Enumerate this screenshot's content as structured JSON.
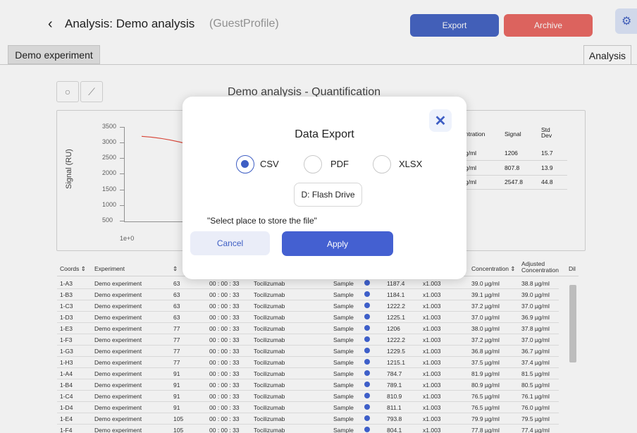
{
  "header": {
    "back_icon": "chevron-left-icon",
    "back_glyph": "‹",
    "title": "Analysis: Demo analysis",
    "profile": "(GuestProfile)",
    "export_label": "Export",
    "archive_label": "Archive",
    "settings_icon": "gear-icon",
    "settings_glyph": "⚙"
  },
  "tabs": {
    "left": "Demo experiment",
    "right": "Analysis"
  },
  "tools": {
    "circle_icon": "circle-select-icon",
    "circle_glyph": "○",
    "line_icon": "line-select-icon",
    "line_glyph": "⟋"
  },
  "chart": {
    "title": "Demo analysis - Quantification",
    "ylabel": "Signal (RU)",
    "yticks": [
      "3500",
      "3000",
      "2500",
      "2000",
      "1500",
      "1000",
      "500"
    ],
    "xtick": "1e+0"
  },
  "chart_data": {
    "type": "line",
    "title": "Demo analysis - Quantification",
    "ylabel": "Signal (RU)",
    "xlabel": "",
    "ylim": [
      0,
      3500
    ],
    "x_ticks": [
      "1e+0"
    ],
    "series": [
      {
        "color": "#e5493a",
        "x": [
          1,
          1.05,
          1.1
        ],
        "values": [
          3100,
          3050,
          2850
        ]
      }
    ]
  },
  "mini_table": {
    "headers": [
      "ntration",
      "Signal",
      "Std Dev"
    ],
    "rows": [
      [
        "g/ml",
        "1206",
        "15.7"
      ],
      [
        "g/ml",
        "807.8",
        "13.9"
      ],
      [
        "g/ml",
        "2547.8",
        "44.8"
      ]
    ]
  },
  "table": {
    "headers": {
      "coords": "Coords",
      "experiment": "Experiment",
      "concentration": "Concentration",
      "adjusted": "Adjusted Concentration",
      "dil": "Dil"
    },
    "rows": [
      [
        "1-A3",
        "Demo experiment",
        "63",
        "00 : 00 : 33",
        "Tocilizumab",
        "Sample",
        "1187.4",
        "x1.003",
        "39.0  µg/ml",
        "38.8  µg/ml"
      ],
      [
        "1-B3",
        "Demo experiment",
        "63",
        "00 : 00 : 33",
        "Tocilizumab",
        "Sample",
        "1184.1",
        "x1.003",
        "39.1  µg/ml",
        "39.0  µg/ml"
      ],
      [
        "1-C3",
        "Demo experiment",
        "63",
        "00 : 00 : 33",
        "Tocilizumab",
        "Sample",
        "1222.2",
        "x1.003",
        "37.2  µg/ml",
        "37.0  µg/ml"
      ],
      [
        "1-D3",
        "Demo experiment",
        "63",
        "00 : 00 : 33",
        "Tocilizumab",
        "Sample",
        "1225.1",
        "x1.003",
        "37.0  µg/ml",
        "36.9  µg/ml"
      ],
      [
        "1-E3",
        "Demo experiment",
        "77",
        "00 : 00 : 33",
        "Tocilizumab",
        "Sample",
        "1206",
        "x1.003",
        "38.0  µg/ml",
        "37.8  µg/ml"
      ],
      [
        "1-F3",
        "Demo experiment",
        "77",
        "00 : 00 : 33",
        "Tocilizumab",
        "Sample",
        "1222.2",
        "x1.003",
        "37.2  µg/ml",
        "37.0  µg/ml"
      ],
      [
        "1-G3",
        "Demo experiment",
        "77",
        "00 : 00 : 33",
        "Tocilizumab",
        "Sample",
        "1229.5",
        "x1.003",
        "36.8  µg/ml",
        "36.7  µg/ml"
      ],
      [
        "1-H3",
        "Demo experiment",
        "77",
        "00 : 00 : 33",
        "Tocilizumab",
        "Sample",
        "1215.1",
        "x1.003",
        "37.5  µg/ml",
        "37.4  µg/ml"
      ],
      [
        "1-A4",
        "Demo experiment",
        "91",
        "00 : 00 : 33",
        "Tocilizumab",
        "Sample",
        "784.7",
        "x1.003",
        "81.9  µg/ml",
        "81.5  µg/ml"
      ],
      [
        "1-B4",
        "Demo experiment",
        "91",
        "00 : 00 : 33",
        "Tocilizumab",
        "Sample",
        "789.1",
        "x1.003",
        "80.9  µg/ml",
        "80.5  µg/ml"
      ],
      [
        "1-C4",
        "Demo experiment",
        "91",
        "00 : 00 : 33",
        "Tocilizumab",
        "Sample",
        "810.9",
        "x1.003",
        "76.5  µg/ml",
        "76.1  µg/ml"
      ],
      [
        "1-D4",
        "Demo experiment",
        "91",
        "00 : 00 : 33",
        "Tocilizumab",
        "Sample",
        "811.1",
        "x1.003",
        "76.5  µg/ml",
        "76.0  µg/ml"
      ],
      [
        "1-E4",
        "Demo experiment",
        "105",
        "00 : 00 : 33",
        "Tocilizumab",
        "Sample",
        "793.8",
        "x1.003",
        "79.9  µg/ml",
        "79.5  µg/ml"
      ],
      [
        "1-F4",
        "Demo experiment",
        "105",
        "00 : 00 : 33",
        "Tocilizumab",
        "Sample",
        "804.1",
        "x1.003",
        "77.8  µg/ml",
        "77.4  µg/ml"
      ]
    ]
  },
  "modal": {
    "close_icon": "close-icon",
    "close_glyph": "✕",
    "title": "Data Export",
    "options": [
      "CSV",
      "PDF",
      "XLSX"
    ],
    "selected": "CSV",
    "drive_label": "D: Flash Drive",
    "prompt": "\"Select place to store the file\"",
    "cancel_label": "Cancel",
    "apply_label": "Apply"
  },
  "colors": {
    "primary": "#4765c4",
    "danger": "#ea6a64",
    "curve": "#e5493a",
    "dot": "#4265d6"
  }
}
